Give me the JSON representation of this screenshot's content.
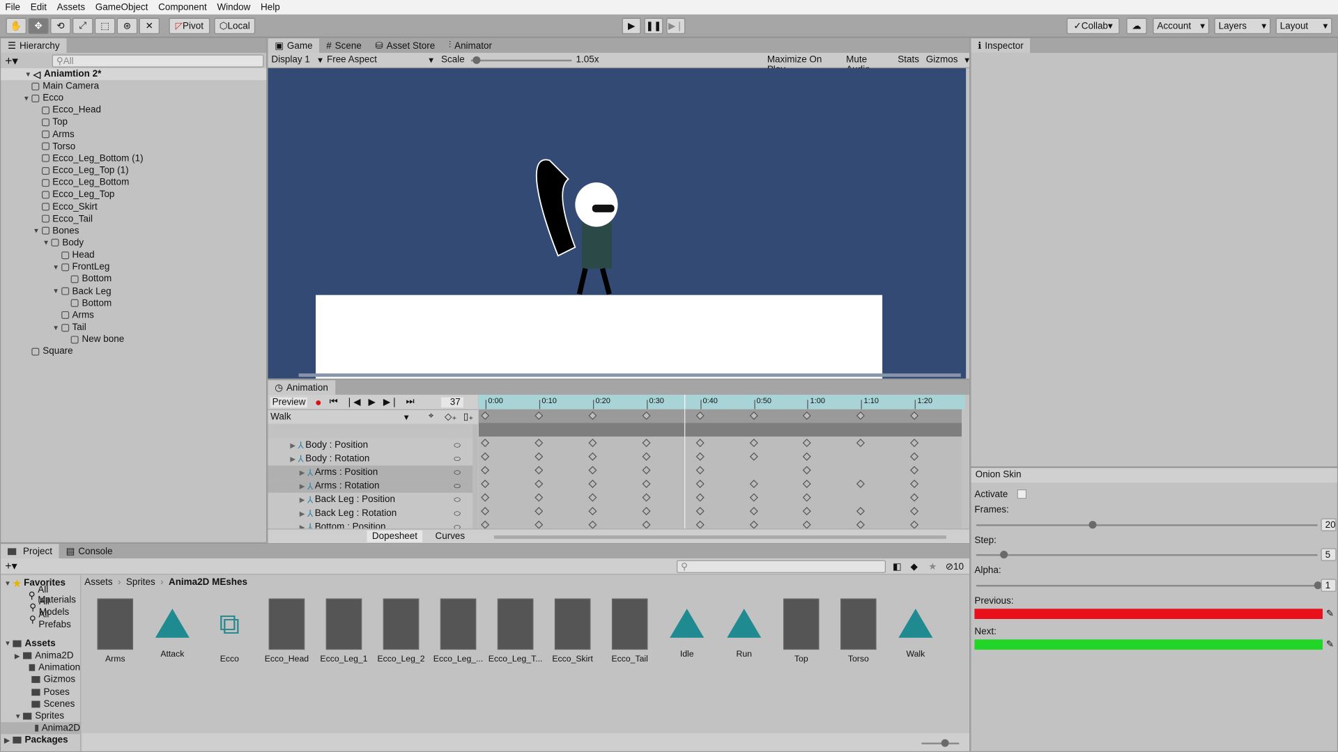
{
  "menu": [
    "File",
    "Edit",
    "Assets",
    "GameObject",
    "Component",
    "Window",
    "Help"
  ],
  "toolbar": {
    "pivot": "Pivot",
    "local": "Local",
    "collab": "Collab",
    "account": "Account",
    "layers": "Layers",
    "layout": "Layout",
    "icons": [
      "hand-icon",
      "move-icon",
      "rotate-icon",
      "scale-icon",
      "rect-icon",
      "transform-icon",
      "custom-tool-icon"
    ]
  },
  "hierarchy": {
    "title": "Hierarchy",
    "search_placeholder": "All",
    "scene": "Aniamtion 2*",
    "items": [
      {
        "label": "Main Camera",
        "depth": 1,
        "exp": ""
      },
      {
        "label": "Ecco",
        "depth": 1,
        "exp": "open"
      },
      {
        "label": "Ecco_Head",
        "depth": 2,
        "exp": ""
      },
      {
        "label": "Top",
        "depth": 2,
        "exp": ""
      },
      {
        "label": "Arms",
        "depth": 2,
        "exp": ""
      },
      {
        "label": "Torso",
        "depth": 2,
        "exp": ""
      },
      {
        "label": "Ecco_Leg_Bottom (1)",
        "depth": 2,
        "exp": ""
      },
      {
        "label": "Ecco_Leg_Top (1)",
        "depth": 2,
        "exp": ""
      },
      {
        "label": "Ecco_Leg_Bottom",
        "depth": 2,
        "exp": ""
      },
      {
        "label": "Ecco_Leg_Top",
        "depth": 2,
        "exp": ""
      },
      {
        "label": "Ecco_Skirt",
        "depth": 2,
        "exp": ""
      },
      {
        "label": "Ecco_Tail",
        "depth": 2,
        "exp": ""
      },
      {
        "label": "Bones",
        "depth": 2,
        "exp": "open"
      },
      {
        "label": "Body",
        "depth": 3,
        "exp": "open"
      },
      {
        "label": "Head",
        "depth": 4,
        "exp": ""
      },
      {
        "label": "FrontLeg",
        "depth": 4,
        "exp": "open"
      },
      {
        "label": "Bottom",
        "depth": 5,
        "exp": ""
      },
      {
        "label": "Back Leg",
        "depth": 4,
        "exp": "open"
      },
      {
        "label": "Bottom",
        "depth": 5,
        "exp": ""
      },
      {
        "label": "Arms",
        "depth": 4,
        "exp": ""
      },
      {
        "label": "Tail",
        "depth": 4,
        "exp": "open"
      },
      {
        "label": "New bone",
        "depth": 5,
        "exp": ""
      },
      {
        "label": "Square",
        "depth": 1,
        "exp": ""
      }
    ]
  },
  "game": {
    "tabs": [
      "Game",
      "Scene",
      "Asset Store",
      "Animator"
    ],
    "display": "Display 1",
    "aspect": "Free Aspect",
    "scale_label": "Scale",
    "scale_value": "1.05x",
    "scale_fraction": 0.05,
    "buttons": [
      "Maximize On Play",
      "Mute Audio",
      "Stats",
      "Gizmos"
    ],
    "bg": "#324a74"
  },
  "animation": {
    "title": "Animation",
    "preview": "Preview",
    "frame": "37",
    "clip": "Walk",
    "times": [
      "0:00",
      "0:10",
      "0:20",
      "0:30",
      "0:40",
      "0:50",
      "1:00",
      "1:10",
      "1:20"
    ],
    "playhead": "0:37",
    "tracks": [
      {
        "label": "Body : Position",
        "indent": 0,
        "keys": [
          0,
          10,
          20,
          30,
          40,
          50,
          60,
          70,
          80
        ]
      },
      {
        "label": "Body : Rotation",
        "indent": 0,
        "keys": [
          0,
          10,
          20,
          30,
          40,
          50,
          60,
          80
        ]
      },
      {
        "label": "Arms : Position",
        "indent": 1,
        "keys": [
          0,
          10,
          20,
          30,
          40,
          60,
          80
        ]
      },
      {
        "label": "Arms : Rotation",
        "indent": 1,
        "keys": [
          0,
          10,
          20,
          30,
          40,
          50,
          60,
          70,
          80
        ]
      },
      {
        "label": "Back Leg : Position",
        "indent": 1,
        "keys": [
          0,
          10,
          20,
          30,
          40,
          50,
          60,
          80
        ]
      },
      {
        "label": "Back Leg : Rotation",
        "indent": 1,
        "keys": [
          0,
          10,
          20,
          30,
          40,
          50,
          60,
          70,
          80
        ]
      },
      {
        "label": "Bottom : Position",
        "indent": 2,
        "keys": [
          0,
          10,
          20,
          30,
          40,
          50,
          60,
          70,
          80
        ]
      }
    ],
    "summary_keys": [
      0,
      10,
      20,
      30,
      40,
      50,
      60,
      70,
      80
    ],
    "bottom_tabs": [
      "Dopesheet",
      "Curves"
    ]
  },
  "inspector": {
    "title": "Inspector"
  },
  "onion": {
    "title": "Onion Skin",
    "activate": "Activate",
    "activate_checked": false,
    "frames_label": "Frames:",
    "frames": "20",
    "frames_fraction": 0.34,
    "step_label": "Step:",
    "step": "5",
    "step_fraction": 0.08,
    "alpha_label": "Alpha:",
    "alpha": "1",
    "alpha_fraction": 1,
    "previous_label": "Previous:",
    "previous_color": "#e8101a",
    "next_label": "Next:",
    "next_color": "#22d627"
  },
  "project": {
    "tabs": [
      "Project",
      "Console"
    ],
    "hidden_count": "10",
    "breadcrumb": [
      "Assets",
      "Sprites",
      "Anima2D MEshes"
    ],
    "favorites": {
      "label": "Favorites",
      "items": [
        "All Materials",
        "All Models",
        "All Prefabs"
      ]
    },
    "assets_root": "Assets",
    "folders": [
      "Anima2D",
      "Animation",
      "Gizmos",
      "Poses",
      "Scenes",
      "Sprites",
      "Anima2D"
    ],
    "packages": "Packages",
    "assets": [
      {
        "name": "Arms",
        "kind": "sprite"
      },
      {
        "name": "Attack",
        "kind": "anim"
      },
      {
        "name": "Ecco",
        "kind": "controller"
      },
      {
        "name": "Ecco_Head",
        "kind": "sprite"
      },
      {
        "name": "Ecco_Leg_1",
        "kind": "sprite"
      },
      {
        "name": "Ecco_Leg_2",
        "kind": "sprite"
      },
      {
        "name": "Ecco_Leg_...",
        "kind": "sprite"
      },
      {
        "name": "Ecco_Leg_T...",
        "kind": "sprite"
      },
      {
        "name": "Ecco_Skirt",
        "kind": "sprite"
      },
      {
        "name": "Ecco_Tail",
        "kind": "sprite"
      },
      {
        "name": "Idle",
        "kind": "anim"
      },
      {
        "name": "Run",
        "kind": "anim"
      },
      {
        "name": "Top",
        "kind": "sprite"
      },
      {
        "name": "Torso",
        "kind": "sprite"
      },
      {
        "name": "Walk",
        "kind": "anim"
      }
    ]
  }
}
